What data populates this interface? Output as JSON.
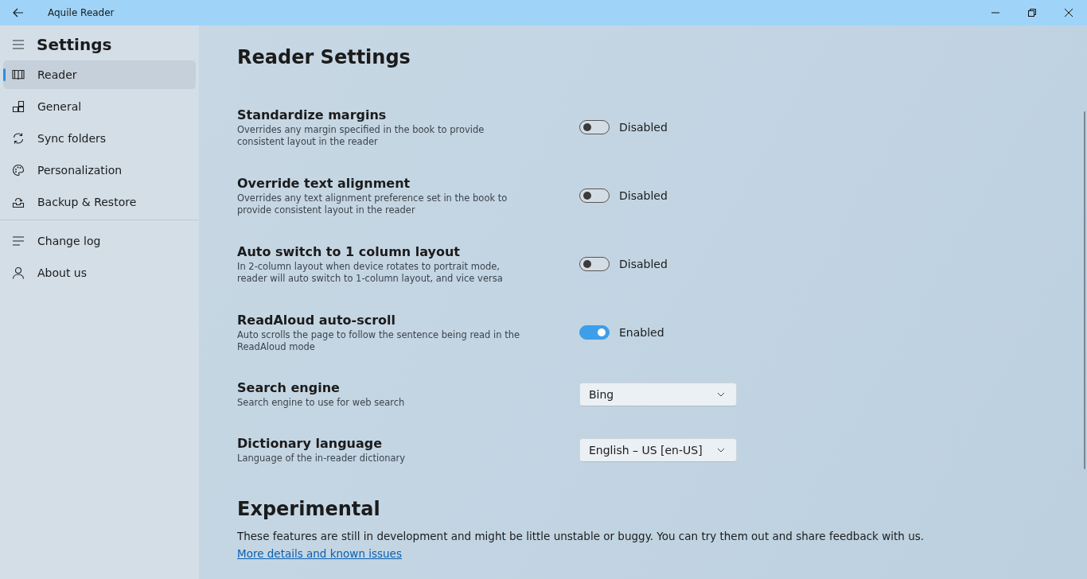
{
  "window": {
    "title": "Aquile Reader"
  },
  "sidebar": {
    "title": "Settings",
    "items": [
      {
        "label": "Reader",
        "selected": true
      },
      {
        "label": "General",
        "selected": false
      },
      {
        "label": "Sync folders",
        "selected": false
      },
      {
        "label": "Personalization",
        "selected": false
      },
      {
        "label": "Backup & Restore",
        "selected": false
      }
    ],
    "footer_items": [
      {
        "label": "Change log",
        "selected": false
      },
      {
        "label": "About us",
        "selected": false
      }
    ]
  },
  "page": {
    "title": "Reader Settings",
    "settings": [
      {
        "kind": "toggle",
        "title": "Standardize margins",
        "description": "Overrides any margin specified in the book to provide consistent layout in the reader",
        "on": false,
        "state_label": "Disabled"
      },
      {
        "kind": "toggle",
        "title": "Override text alignment",
        "description": "Overrides any text alignment preference set in the book to provide consistent layout in the reader",
        "on": false,
        "state_label": "Disabled"
      },
      {
        "kind": "toggle",
        "title": "Auto switch to 1 column layout",
        "description": "In 2-column layout when device rotates to portrait mode, reader will auto switch to 1-column layout, and vice versa",
        "on": false,
        "state_label": "Disabled"
      },
      {
        "kind": "toggle",
        "title": "ReadAloud auto-scroll",
        "description": "Auto scrolls the page to follow the sentence being read in the ReadAloud mode",
        "on": true,
        "state_label": "Enabled"
      },
      {
        "kind": "dropdown",
        "title": "Search engine",
        "description": "Search engine to use for web search",
        "value": "Bing"
      },
      {
        "kind": "dropdown",
        "title": "Dictionary language",
        "description": "Language of the in-reader dictionary",
        "value": "English – US [en-US]"
      }
    ],
    "experimental": {
      "title": "Experimental",
      "text": "These features are still in development and might be little unstable or buggy. You can try them out and share feedback with us.",
      "link": "More details and known issues"
    }
  }
}
